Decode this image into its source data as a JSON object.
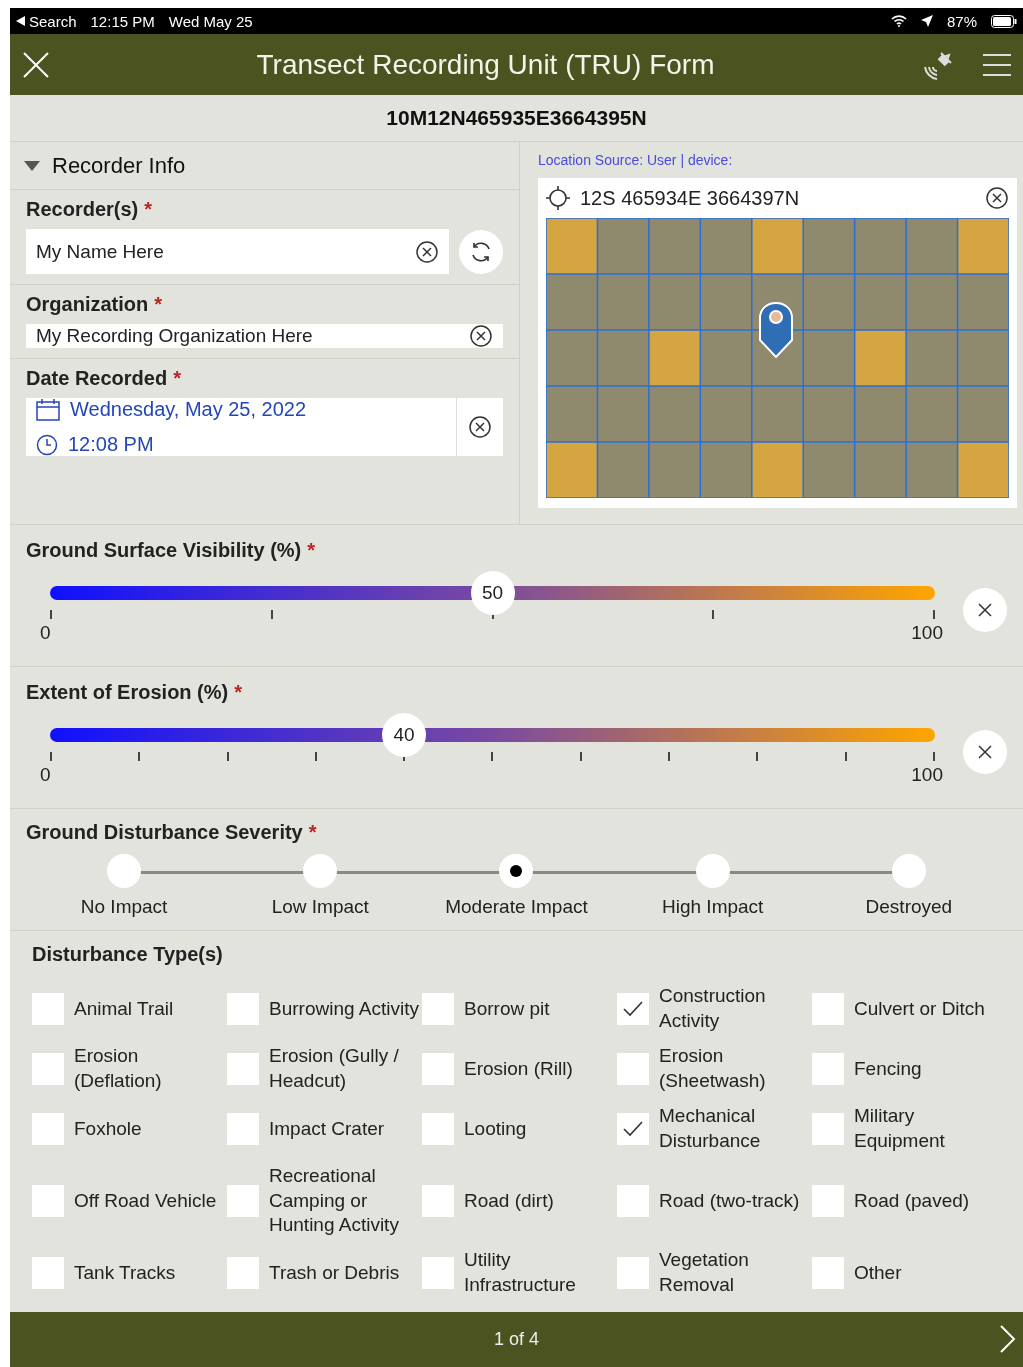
{
  "status_bar": {
    "back_label": "Search",
    "time": "12:15 PM",
    "date": "Wed May 25",
    "battery": "87%"
  },
  "header": {
    "title": "Transect Recording Unit (TRU) Form"
  },
  "record_id": "10M12N465935E3664395N",
  "recorder_info": {
    "title": "Recorder Info",
    "expanded": true,
    "recorders": {
      "label": "Recorder(s)",
      "required": "*",
      "value": "My Name Here"
    },
    "organization": {
      "label": "Organization",
      "required": "*",
      "value": "My Recording Organization Here"
    },
    "date_recorded": {
      "label": "Date Recorded",
      "required": "*",
      "date": "Wednesday, May 25, 2022",
      "time": "12:08 PM"
    }
  },
  "location": {
    "source": "Location Source: User | device:",
    "coordinates": "12S 465934E 3664397N"
  },
  "sliders": [
    {
      "label": "Ground Surface Visibility (%)",
      "required": "*",
      "level": 0.5,
      "value": "50",
      "min": "0",
      "max": "100"
    },
    {
      "label": "Extent of Erosion (%)",
      "required": "*",
      "level": 0.4,
      "value": "40",
      "min": "0",
      "max": "100"
    }
  ],
  "severity": {
    "label": "Ground Disturbance Severity",
    "required": "*",
    "options": [
      {
        "label": "No Impact",
        "selected": false
      },
      {
        "label": "Low Impact",
        "selected": false
      },
      {
        "label": "Moderate Impact",
        "selected": true
      },
      {
        "label": "High Impact",
        "selected": false
      },
      {
        "label": "Destroyed",
        "selected": false
      }
    ]
  },
  "disturbance_types": {
    "label": "Disturbance Type(s)",
    "items": [
      {
        "label": "Animal Trail",
        "checked": false
      },
      {
        "label": "Burrowing Activity",
        "checked": false
      },
      {
        "label": "Borrow pit",
        "checked": false
      },
      {
        "label": "Construction Activity",
        "checked": true
      },
      {
        "label": "Culvert or Ditch",
        "checked": false
      },
      {
        "label": "Erosion (Deflation)",
        "checked": false
      },
      {
        "label": "Erosion (Gully / Headcut)",
        "checked": false
      },
      {
        "label": "Erosion (Rill)",
        "checked": false
      },
      {
        "label": "Erosion (Sheetwash)",
        "checked": false
      },
      {
        "label": "Fencing",
        "checked": false
      },
      {
        "label": "Foxhole",
        "checked": false
      },
      {
        "label": "Impact Crater",
        "checked": false
      },
      {
        "label": "Looting",
        "checked": false
      },
      {
        "label": "Mechanical Disturbance",
        "checked": true
      },
      {
        "label": "Military Equipment",
        "checked": false
      },
      {
        "label": "Off Road Vehicle",
        "checked": false
      },
      {
        "label": "Recreational Camping or Hunting Activity",
        "checked": false
      },
      {
        "label": "Road (dirt)",
        "checked": false
      },
      {
        "label": "Road (two-track)",
        "checked": false
      },
      {
        "label": "Road (paved)",
        "checked": false
      },
      {
        "label": "Tank Tracks",
        "checked": false
      },
      {
        "label": "Trash or Debris",
        "checked": false
      },
      {
        "label": "Utility Infrastructure",
        "checked": false
      },
      {
        "label": "Vegetation Removal",
        "checked": false
      },
      {
        "label": "Other",
        "checked": false
      }
    ]
  },
  "footer": {
    "page": "1 of 4"
  }
}
